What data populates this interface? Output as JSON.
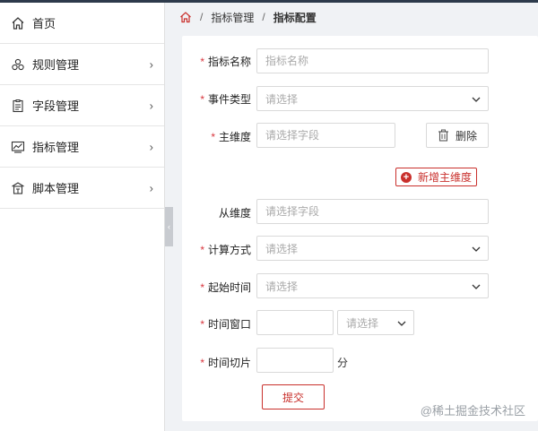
{
  "sidebar": {
    "items": [
      {
        "label": "首页",
        "icon": "home-icon",
        "has_children": false
      },
      {
        "label": "规则管理",
        "icon": "rules-icon",
        "has_children": true
      },
      {
        "label": "字段管理",
        "icon": "clipboard-icon",
        "has_children": true
      },
      {
        "label": "指标管理",
        "icon": "chart-monitor-icon",
        "has_children": true
      },
      {
        "label": "脚本管理",
        "icon": "script-home-icon",
        "has_children": true
      }
    ],
    "chevron": "›"
  },
  "breadcrumb": {
    "sep": "/",
    "level1": "指标管理",
    "current": "指标配置"
  },
  "form": {
    "required_mark": "*",
    "metric_name": {
      "label": "指标名称",
      "placeholder": "指标名称",
      "required": true
    },
    "event_type": {
      "label": "事件类型",
      "placeholder": "请选择",
      "required": true
    },
    "main_dimension": {
      "label": "主维度",
      "placeholder": "请选择字段",
      "required": true
    },
    "delete_button": "删除",
    "add_main_dimension_button": "新增主维度",
    "sub_dimension": {
      "label": "从维度",
      "placeholder": "请选择字段",
      "required": false
    },
    "calc_method": {
      "label": "计算方式",
      "placeholder": "请选择",
      "required": true
    },
    "start_time": {
      "label": "起始时间",
      "placeholder": "请选择",
      "required": true
    },
    "time_window": {
      "label": "时间窗口",
      "value": "",
      "unit_placeholder": "请选择",
      "required": true
    },
    "time_slice": {
      "label": "时间切片",
      "value": "",
      "unit": "分",
      "required": true
    },
    "submit_button": "提交"
  },
  "watermark": "@稀土掘金技术社区",
  "colors": {
    "accent": "#c9302c",
    "required": "#d9363e",
    "sidebar_bg": "#ffffff",
    "page_bg": "#f0f2f5"
  }
}
